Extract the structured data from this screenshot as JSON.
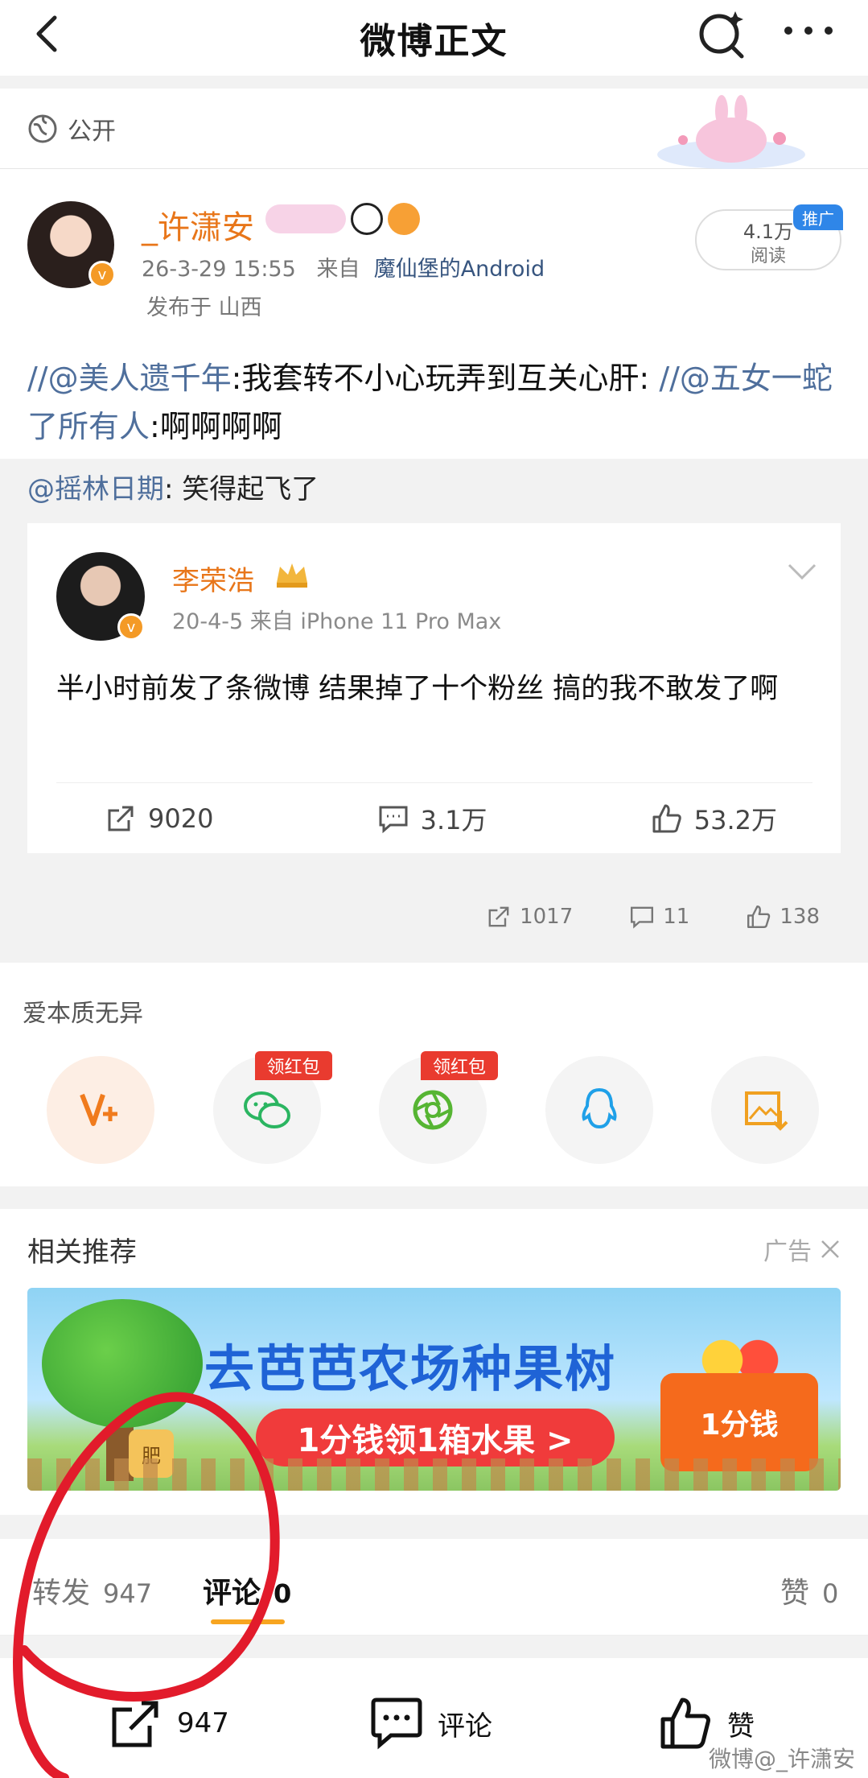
{
  "header": {
    "title": "微博正文",
    "back_icon": "back-icon",
    "search_icon": "search-icon",
    "more_icon": "more-icon"
  },
  "post": {
    "privacy": "公开",
    "author": {
      "name": "_许潇安",
      "time": "26-3-29 15:55",
      "from_prefix": "来自",
      "client": "魔仙堡的Android",
      "location": "发布于 山西",
      "verified_mark": "v"
    },
    "reads": {
      "count": "4.1万",
      "label": "阅读",
      "promo": "推广"
    },
    "repost_chain": [
      {
        "at": "//@美人遗千年",
        "text": ":我套转不小心玩弄到互关心肝:"
      },
      {
        "at": "//@五女一蛇了所有人",
        "text": ":啊啊啊啊"
      }
    ],
    "quote": {
      "at": "@摇林日期",
      "text": ": 笑得起飞了"
    },
    "original": {
      "name": "李荣浩",
      "time_source": "20-4-5  来自 iPhone 11 Pro Max",
      "text": "半小时前发了条微博 结果掉了十个粉丝 搞的我不敢发了啊",
      "actions": {
        "repost": "9020",
        "comment": "3.1万",
        "like": "53.2万"
      }
    },
    "actions": {
      "repost": "1017",
      "comment": "11",
      "like": "138"
    }
  },
  "share": {
    "title": "爱本质无异",
    "red_tag": "领红包",
    "targets": [
      "vplus-icon",
      "wechat-icon",
      "moments-icon",
      "qq-icon",
      "save-image-icon"
    ]
  },
  "related": {
    "title": "相关推荐",
    "ad_label": "广告",
    "banner": {
      "headline": "去芭芭农场种果树",
      "cta": "1分钱领1箱水果 >",
      "box_label": "1分钱",
      "bag_label": "肥"
    }
  },
  "tabs": {
    "repost_label": "转发",
    "repost_count": "947",
    "comment_label": "评论",
    "comment_count": "0",
    "like_label": "赞",
    "like_count": "0"
  },
  "bottombar": {
    "repost_count": "947",
    "comment_label": "评论",
    "like_label": "赞",
    "watermark": "微博@_许潇安"
  },
  "colors": {
    "accent_orange": "#e8761a",
    "link_blue": "#4f6f9c",
    "promo_blue": "#2f86e8",
    "red_tag": "#e93b2f",
    "tab_underline": "#f7a520",
    "annotation_red": "#e21b2b"
  }
}
